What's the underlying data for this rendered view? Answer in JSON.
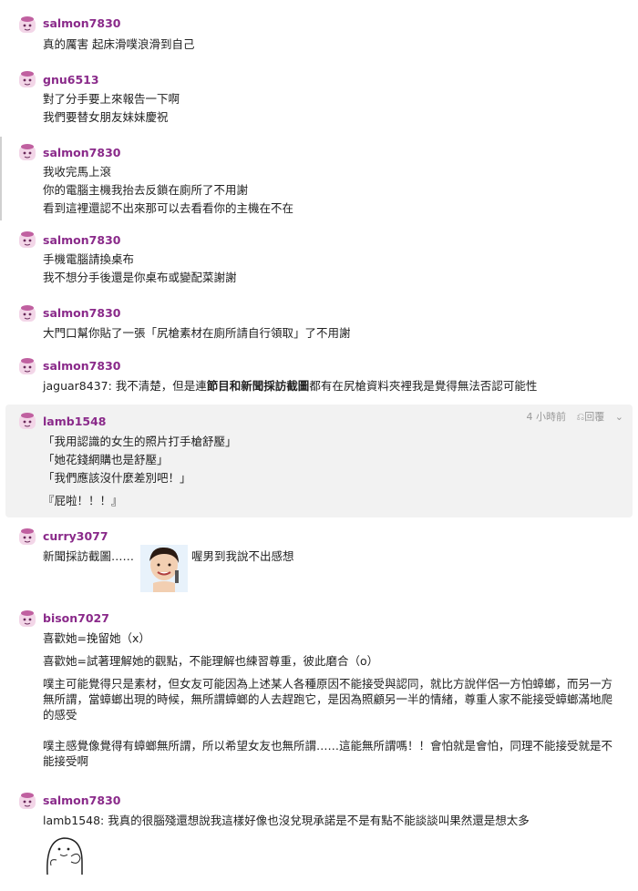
{
  "colors": {
    "username": "#8a2a8a",
    "highlight_bg": "#f2f2f2",
    "meta": "#999999"
  },
  "comments": [
    {
      "user": "salmon7830",
      "lines": [
        "真的厲害 起床滑噗浪滑到自己"
      ]
    },
    {
      "user": "gnu6513",
      "lines": [
        "對了分手要上來報告一下啊",
        "我們要替女朋友妹妹慶祝"
      ]
    },
    {
      "user": "salmon7830",
      "lines": [
        "我收完馬上滾",
        "你的電腦主機我抬去反鎖在廁所了不用謝",
        "看到這裡還認不出來那可以去看看你的主機在不在"
      ]
    },
    {
      "user": "salmon7830",
      "lines": [
        "手機電腦請換桌布",
        "我不想分手後還是你桌布或變配菜謝謝"
      ]
    },
    {
      "user": "salmon7830",
      "lines": [
        "大門口幫你貼了一張「尻槍素材在廁所請自行領取」了不用謝"
      ]
    },
    {
      "user": "salmon7830",
      "mention": "jaguar8437:",
      "line_pre": " 我不清楚，但是連",
      "line_bold": "節目和新聞採訪截圖",
      "line_post": "都有在尻槍資料夾裡我是覺得無法否認可能性"
    },
    {
      "user": "lamb1548",
      "time": "4 小時前",
      "reply": "回覆",
      "lines": [
        "「我用認識的女生的照片打手槍舒壓」",
        "「她花錢網購也是舒壓」",
        "「我們應該沒什麼差別吧！」",
        "『屁啦！！！』"
      ]
    },
    {
      "user": "curry3077",
      "lines": [
        "新聞採訪截圖……",
        "喔男到我說不出感想"
      ]
    },
    {
      "user": "bison7027",
      "lines": [
        "喜歡她=挽留她（x）",
        "喜歡她=試著理解她的觀點，不能理解也練習尊重，彼此磨合（o）",
        "噗主可能覺得只是素材，但女友可能因為上述某人各種原因不能接受與認同，就比方說伴侶一方怕蟑螂，而另一方無所謂，當蟑螂出現的時候，無所謂蟑螂的人去趕跑它，是因為照顧另一半的情緒，尊重人家不能接受蟑螂滿地爬的感受",
        "噗主感覺像覺得有蟑螂無所謂，所以希望女友也無所謂……這能無所謂嗎！！會怕就是會怕，同理不能接受就是不能接受啊"
      ]
    },
    {
      "user": "salmon7830",
      "mention": "lamb1548:",
      "line_pre": " 我真的很腦殘還想說我這樣好像也沒兌現承諾是不是有點不能談談叫果然還是想太多"
    }
  ]
}
